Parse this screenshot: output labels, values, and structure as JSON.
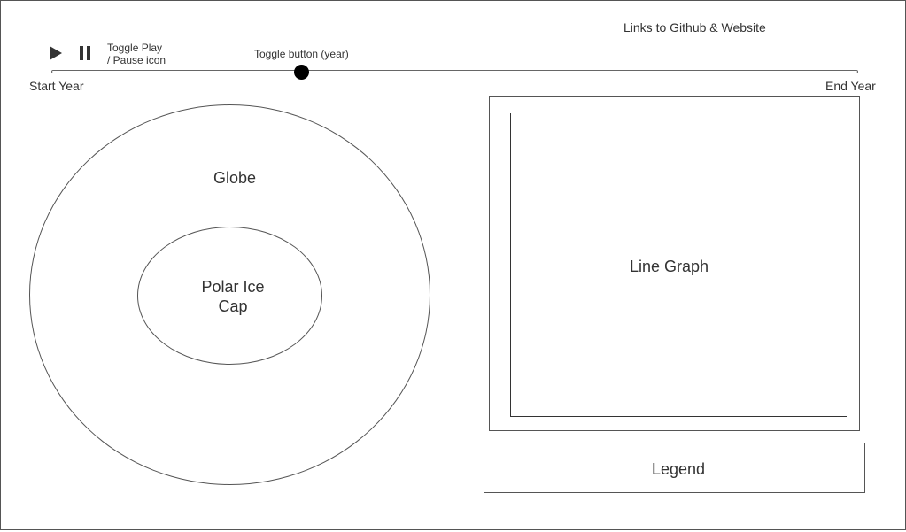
{
  "header": {
    "links_text": "Links to Github & Website"
  },
  "controls": {
    "play_icon": "play-icon",
    "pause_icon": "pause-icon",
    "toggle_label_line1": "Toggle Play",
    "toggle_label_line2": "/ Pause icon",
    "slider_label": "Toggle button (year)",
    "start_label": "Start Year",
    "end_label": "End Year",
    "slider_position": 0.31
  },
  "globe": {
    "label": "Globe",
    "icecap_line1": "Polar Ice",
    "icecap_line2": "Cap"
  },
  "graph": {
    "label": "Line Graph"
  },
  "legend": {
    "label": "Legend"
  }
}
